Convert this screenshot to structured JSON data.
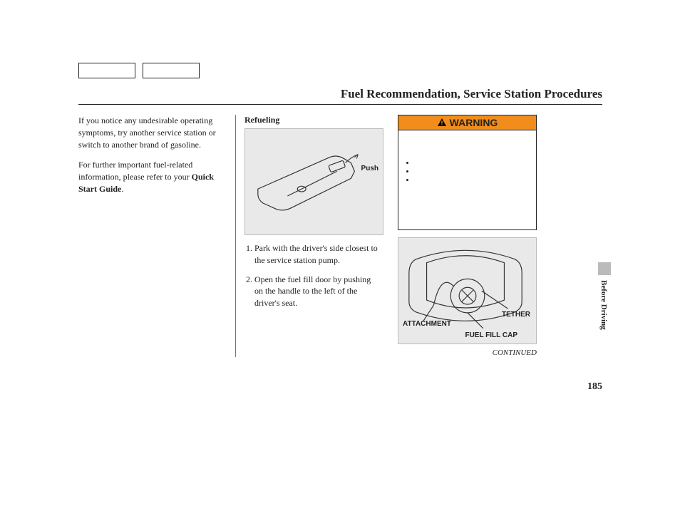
{
  "title": "Fuel Recommendation, Service Station Procedures",
  "col1": {
    "p1": "If you notice any undesirable operating symptoms, try another service station or switch to another brand of gasoline.",
    "p2a": "For further important fuel-related information, please refer to your ",
    "p2b": "Quick Start Guide",
    "p2c": "."
  },
  "col2": {
    "subhead": "Refueling",
    "pushLabel": "Push",
    "step1": "Park with the driver's side closest to the service station pump.",
    "step2": "Open the fuel fill door by pushing on the handle to the left of the driver's seat."
  },
  "col3": {
    "warning": "WARNING",
    "tether": "TETHER",
    "attachment": "ATTACHMENT",
    "fuelCap": "FUEL FILL CAP",
    "continued": "CONTINUED"
  },
  "sideLabel": "Before Driving",
  "pageNumber": "185"
}
